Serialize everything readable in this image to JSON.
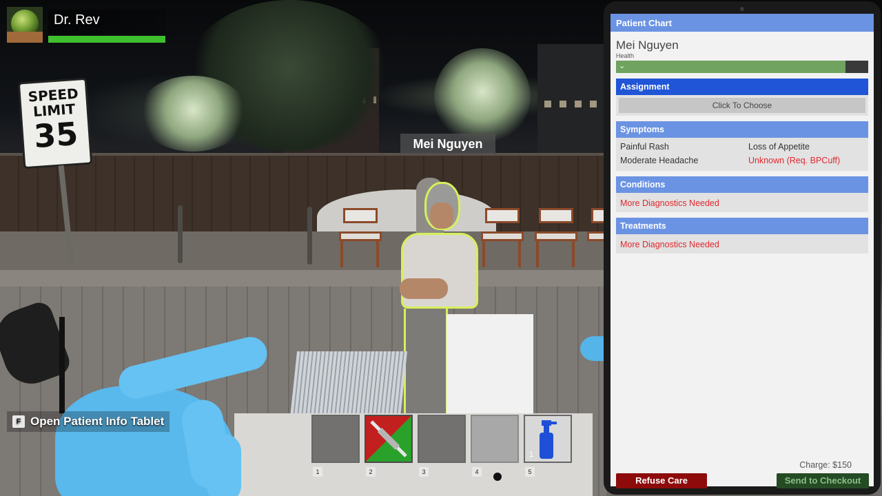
{
  "player": {
    "name": "Dr. Rev",
    "health_fraction": 1.0
  },
  "scene": {
    "sign_line1": "SPEED",
    "sign_line2": "LIMIT",
    "sign_line3": "35",
    "patient_nametag": "Mei Nguyen"
  },
  "prompt": {
    "key": "F",
    "text": "Open Patient Info Tablet"
  },
  "hotbar": {
    "slots": [
      {
        "key": "1",
        "item": "empty"
      },
      {
        "key": "2",
        "item": "syringe"
      },
      {
        "key": "3",
        "item": "empty"
      },
      {
        "key": "4",
        "item": "gray-pad"
      },
      {
        "key": "5",
        "item": "spray-bottle",
        "count": "1"
      }
    ]
  },
  "tablet": {
    "header": "Patient Chart",
    "patient_name": "Mei Nguyen",
    "health_label": "Health",
    "health_fraction": 0.91,
    "assignment": {
      "title": "Assignment",
      "button": "Click To Choose"
    },
    "symptoms": {
      "title": "Symptoms",
      "items": [
        "Painful Rash",
        "Loss of Appetite",
        "Moderate Headache",
        "Unknown (Req. BPCuff)"
      ]
    },
    "conditions": {
      "title": "Conditions",
      "text": "More Diagnostics Needed"
    },
    "treatments": {
      "title": "Treatments",
      "text": "More Diagnostics Needed"
    },
    "charge": "Charge: $150",
    "refuse_label": "Refuse Care",
    "checkout_label": "Send to Checkout"
  },
  "colors": {
    "accent_header": "#6b93e3",
    "accent_dark": "#1f55d6",
    "warning_text": "#e0282e",
    "refuse": "#8e0b0b",
    "checkout": "#254b24",
    "outline": "#d6f05a"
  }
}
